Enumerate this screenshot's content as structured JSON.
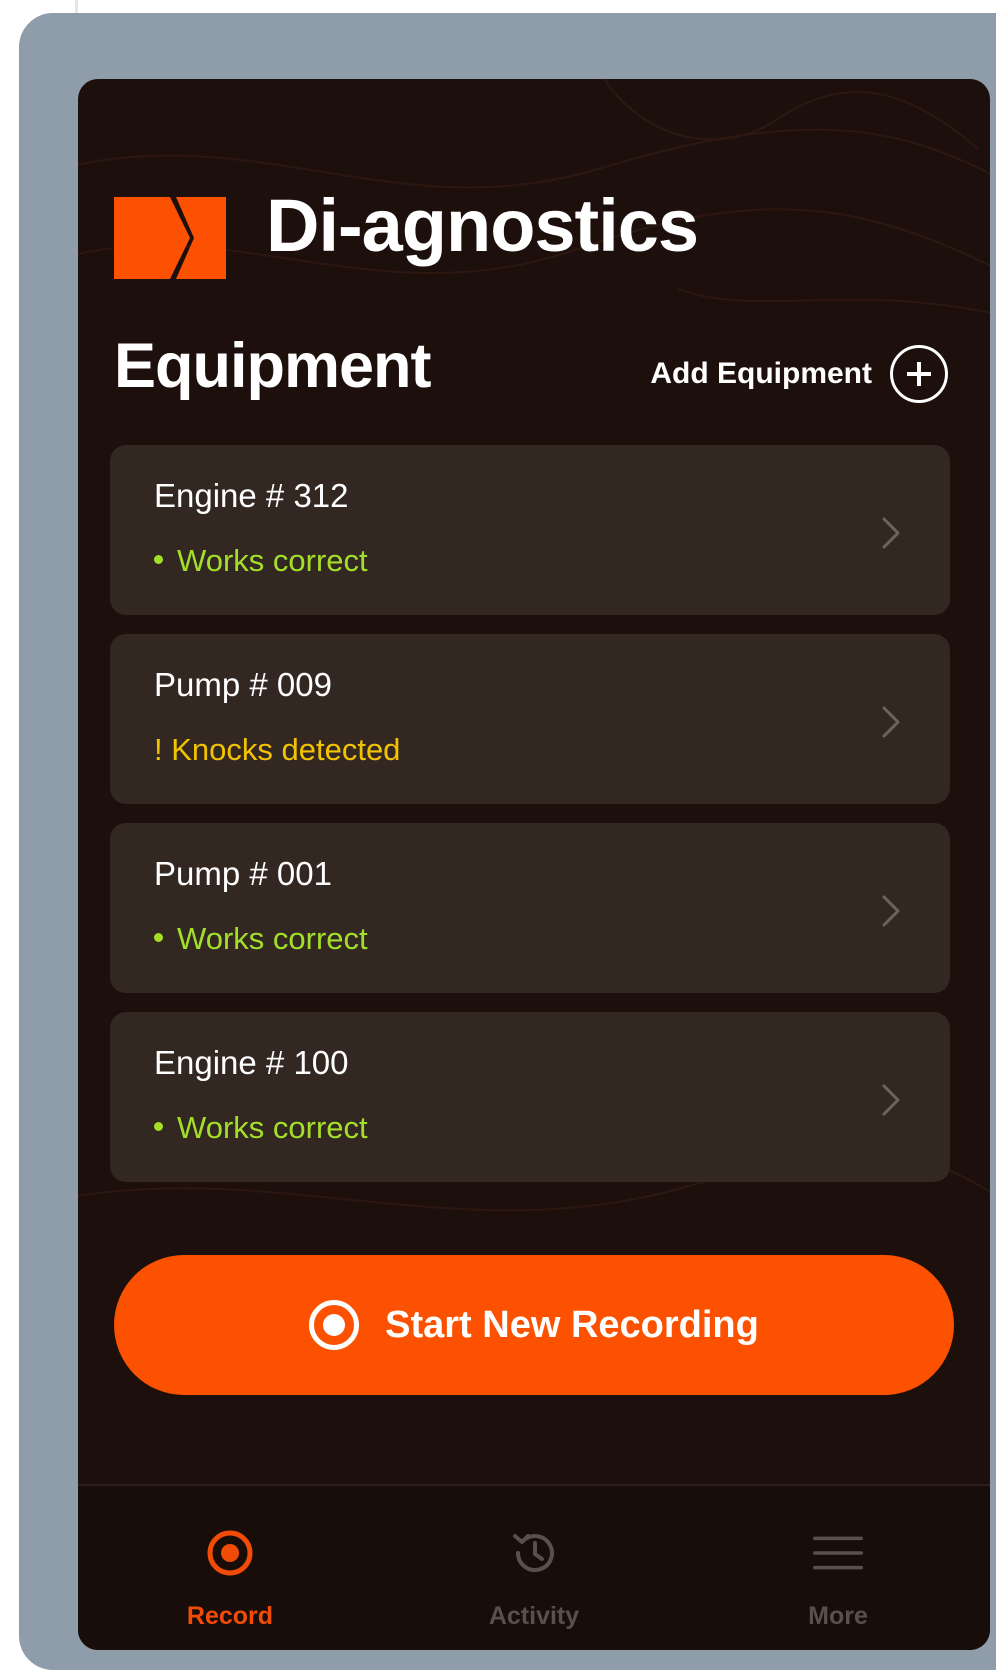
{
  "app": {
    "name": "Di-agnostics",
    "logo_icon": "di-agnostics-logo",
    "brand_color": "#fc5100"
  },
  "header": {
    "section_title": "Equipment",
    "add_equipment_label": "Add Equipment",
    "add_icon": "plus-circle-icon"
  },
  "equipment": [
    {
      "name": "Engine # 312",
      "status": "Works correct",
      "status_type": "ok"
    },
    {
      "name": "Pump # 009",
      "status": "! Knocks detected",
      "status_type": "warning"
    },
    {
      "name": "Pump # 001",
      "status": "Works correct",
      "status_type": "ok"
    },
    {
      "name": "Engine # 100",
      "status": "Works correct",
      "status_type": "ok"
    }
  ],
  "status_colors": {
    "ok": "#a3df28",
    "warning": "#f2c300"
  },
  "primary_action": {
    "label": "Start New Recording",
    "icon": "record-icon"
  },
  "bottom_nav": [
    {
      "label": "Record",
      "icon": "record-icon",
      "active": true
    },
    {
      "label": "Activity",
      "icon": "history-icon",
      "active": false
    },
    {
      "label": "More",
      "icon": "menu-icon",
      "active": false
    }
  ]
}
